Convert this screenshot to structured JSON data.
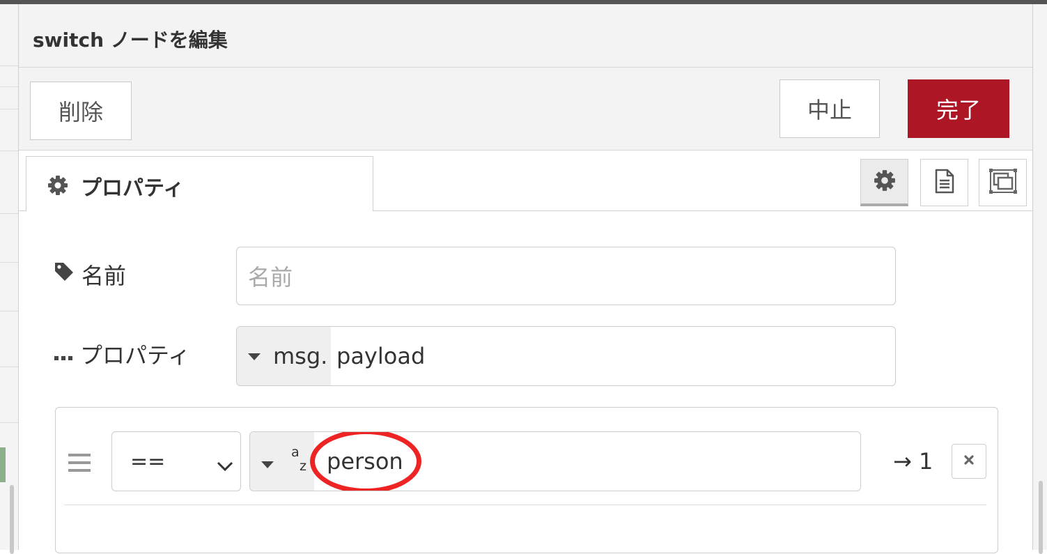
{
  "dialog": {
    "title": "switch ノードを編集",
    "buttons": {
      "delete": "削除",
      "cancel": "中止",
      "done": "完了"
    },
    "colors": {
      "primary": "#ad1625",
      "highlight_circle": "#ee2424"
    }
  },
  "tabs": {
    "active": {
      "label": "プロパティ",
      "icon": "gear-icon"
    },
    "icon_buttons": [
      {
        "icon": "gear-icon",
        "selected": true
      },
      {
        "icon": "document-icon",
        "selected": false
      },
      {
        "icon": "frames-icon",
        "selected": false
      }
    ]
  },
  "form": {
    "name": {
      "label": "名前",
      "icon": "tag-icon",
      "placeholder": "名前",
      "value": ""
    },
    "property": {
      "label": "プロパティ",
      "icon": "ellipsis-icon",
      "type_prefix": "msg.",
      "value": "payload"
    }
  },
  "rules": [
    {
      "operator": "==",
      "value_type_icon": "string-az-icon",
      "value_type_a": "a",
      "value_type_z": "z",
      "value": "person",
      "output": "→ 1",
      "highlighted": true
    }
  ]
}
